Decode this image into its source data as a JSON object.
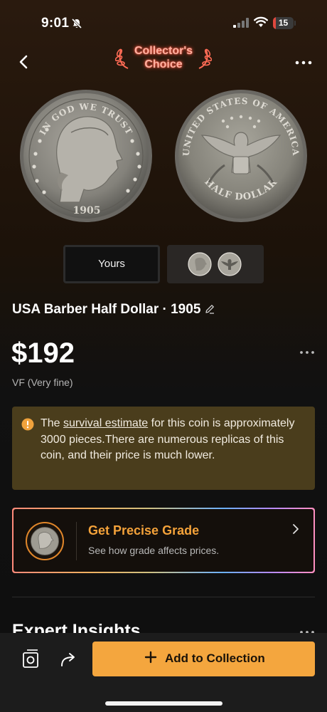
{
  "status_bar": {
    "time": "9:01",
    "battery_level": "15",
    "battery_fraction": 0.15
  },
  "header": {
    "badge_line1": "Collector's",
    "badge_line2": "Choice",
    "back_icon": "chevron-left-icon",
    "more_icon": "more-horizontal-icon"
  },
  "gallery": {
    "front_legend": "IN GOD WE TRUST",
    "front_year": "1905",
    "back_legend": "UNITED STATES OF AMERICA",
    "back_denomination": "HALF DOLLAR",
    "tabs": {
      "yours": "Yours"
    }
  },
  "coin": {
    "title": "USA Barber Half Dollar · 1905",
    "price": "$192",
    "grade": "VF (Very fine)"
  },
  "warning": {
    "prefix": "The ",
    "link": "survival estimate",
    "suffix": " for this coin is approximately 3000 pieces.There are numerous replicas of this coin, and their price is much lower."
  },
  "grade_card": {
    "title": "Get Precise Grade",
    "subtitle": "See how grade affects prices."
  },
  "section": {
    "title": "Expert Insights"
  },
  "bottom_bar": {
    "add_label": "Add to Collection"
  },
  "colors": {
    "accent": "#f4a63e",
    "warning_bg": "#4a3d1c",
    "grade_title": "#f4a23a"
  }
}
